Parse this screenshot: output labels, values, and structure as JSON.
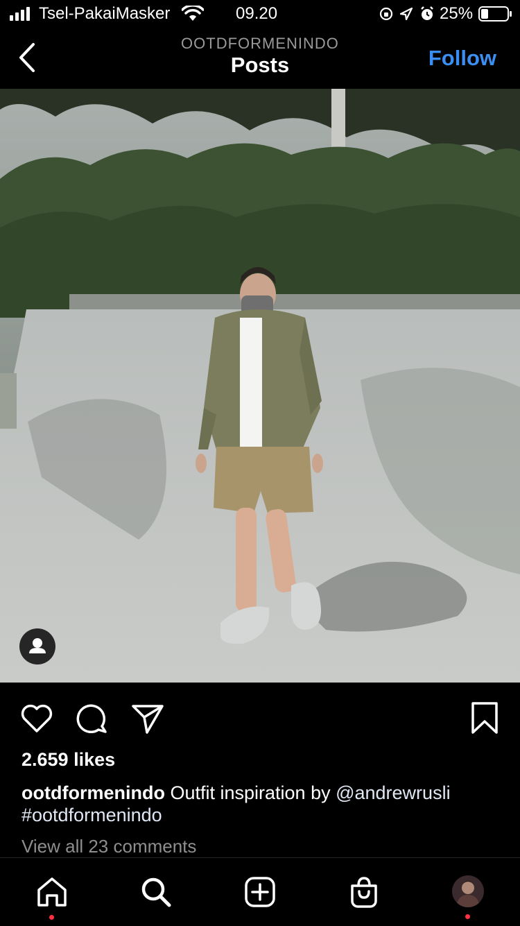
{
  "status_bar": {
    "carrier": "Tsel-PakaiMasker",
    "time": "09.20",
    "battery": "25%"
  },
  "header": {
    "account": "OOTDFORMENINDO",
    "title": "Posts",
    "follow_label": "Follow"
  },
  "post": {
    "likes": "2.659 likes",
    "caption_user": "ootdformenindo",
    "caption_text": " Outfit inspiration by ",
    "caption_mention": "@andrewrusli",
    "caption_hashtag": "#ootdformenindo",
    "comments_link": "View all 23 comments"
  },
  "icons": {
    "back": "chevron-left-icon",
    "like": "heart-icon",
    "comment": "comment-bubble-icon",
    "share": "paper-plane-icon",
    "save": "bookmark-icon",
    "user_tag": "person-icon",
    "tabs": [
      "home-icon",
      "search-icon",
      "new-post-icon",
      "shop-bag-icon",
      "profile-avatar"
    ]
  },
  "colors": {
    "accent": "#3b8ff3",
    "background": "#000000",
    "notification_dot": "#ff3040",
    "secondary_text": "#8e8e8e"
  }
}
